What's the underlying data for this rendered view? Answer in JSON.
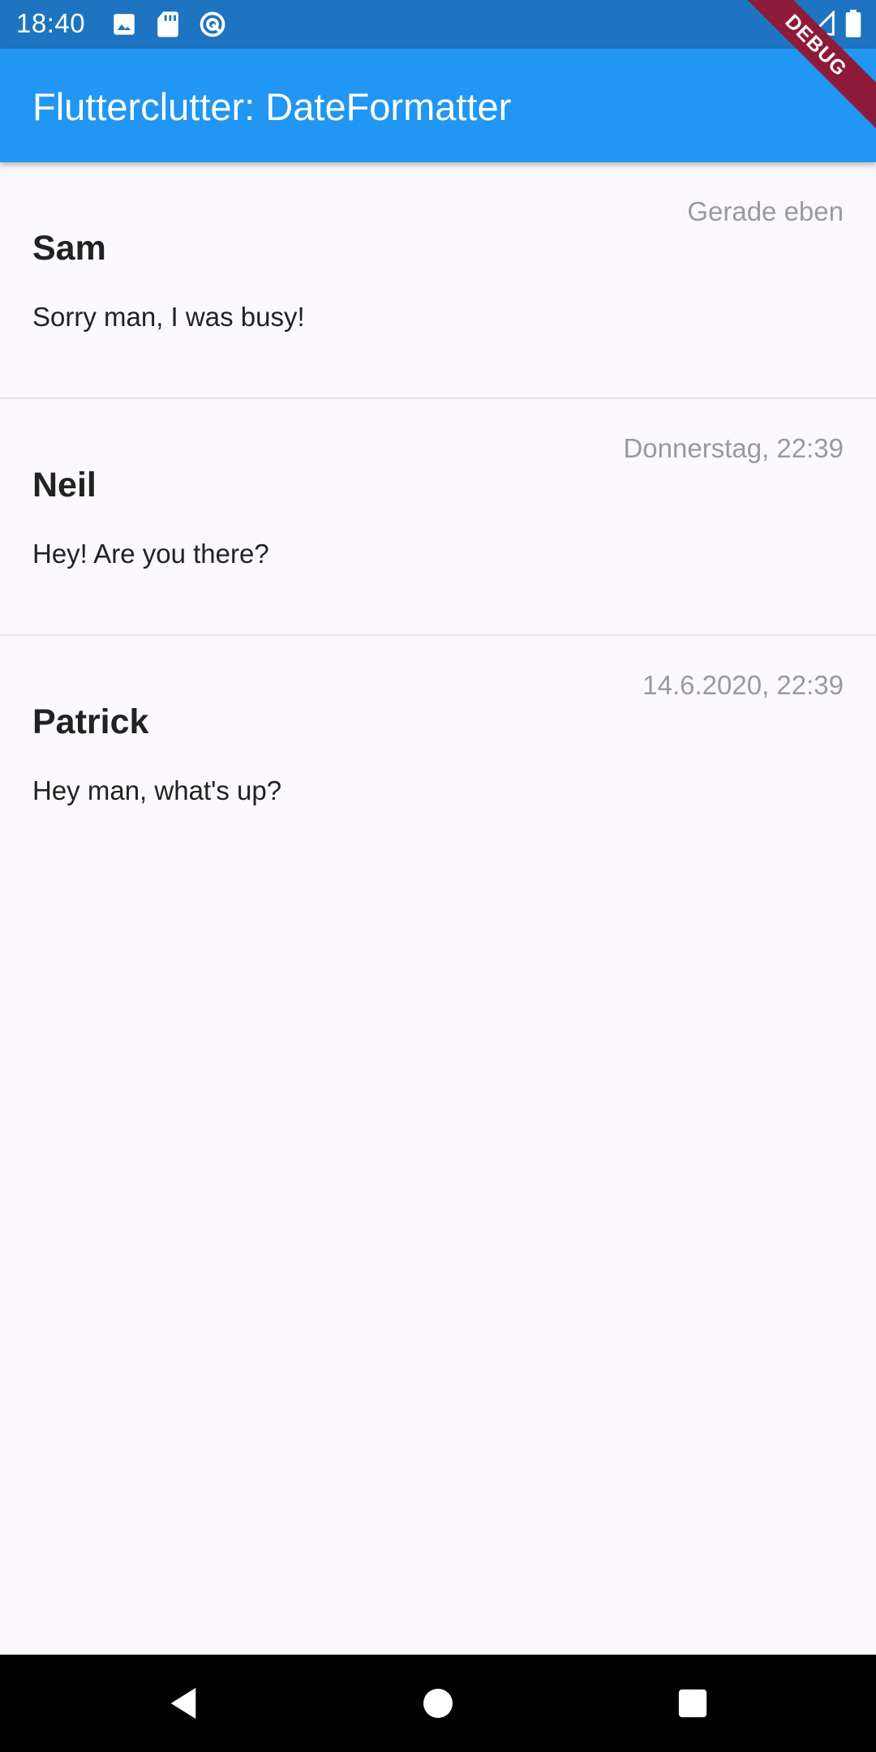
{
  "status_bar": {
    "time": "18:40",
    "left_icons": [
      "image-icon",
      "sd-card-icon",
      "sync-icon"
    ],
    "right_icons": [
      "wifi-icon",
      "signal-icon",
      "battery-icon"
    ]
  },
  "app_bar": {
    "title": "Flutterclutter: DateFormatter",
    "color": "#2196f3"
  },
  "debug_banner": {
    "label": "DEBUG"
  },
  "messages": [
    {
      "name": "Sam",
      "text": "Sorry man, I was busy!",
      "time": "Gerade eben"
    },
    {
      "name": "Neil",
      "text": "Hey! Are you there?",
      "time": "Donnerstag, 22:39"
    },
    {
      "name": "Patrick",
      "text": "Hey man, what's up?",
      "time": "14.6.2020, 22:39"
    }
  ],
  "nav_bar": {
    "buttons": [
      "back-icon",
      "home-icon",
      "recents-icon"
    ]
  }
}
